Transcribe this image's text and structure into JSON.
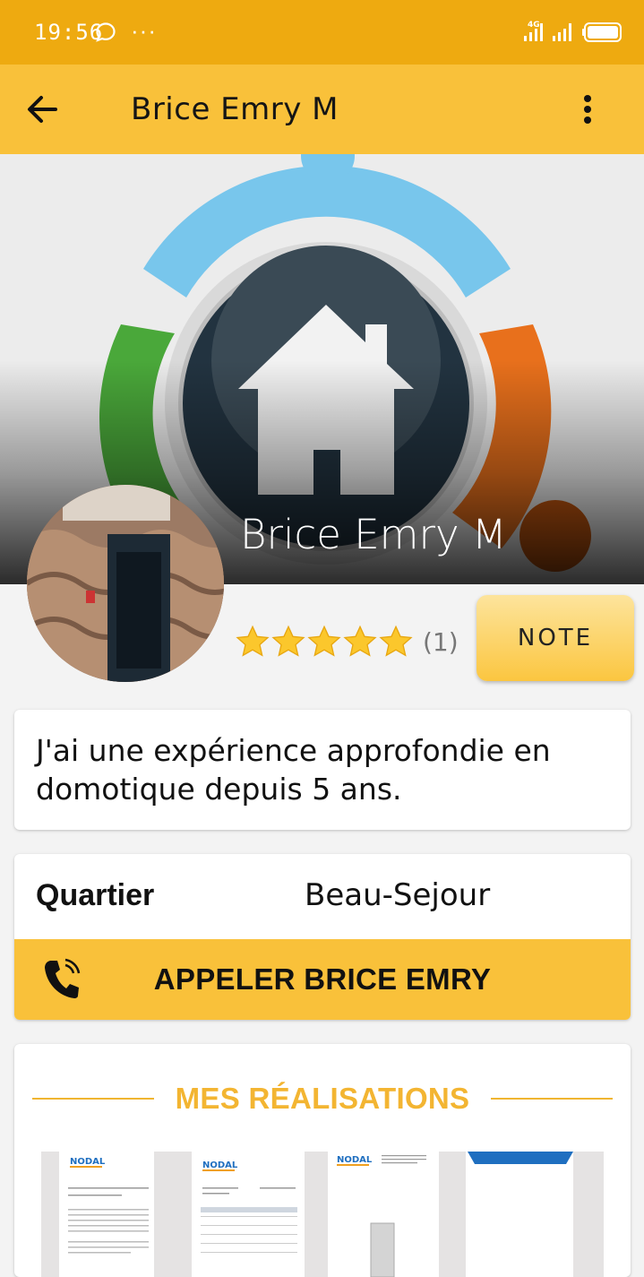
{
  "status_bar": {
    "time": "19:56",
    "dots": "···",
    "network": "4G",
    "icons": [
      "chat-bubble-icon",
      "signal-icon",
      "signal-icon",
      "battery-icon"
    ]
  },
  "app_bar": {
    "title": "Brice Emry M",
    "back_icon": "arrow-left-icon",
    "menu_icon": "more-vert-icon"
  },
  "hero": {
    "name": "Brice Emry M",
    "cover_image": "domotique-house-logo"
  },
  "profile": {
    "rating_stars": 5,
    "rating_count": "(1)",
    "note_button": "NOTE"
  },
  "description": "J'ai une expérience approfondie en domotique depuis 5 ans.",
  "info": {
    "quartier_label": "Quartier",
    "quartier_value": "Beau-Sejour",
    "call_button": "APPELER BRICE EMRY",
    "call_icon": "phone-icon"
  },
  "realisations": {
    "title": "MES RÉALISATIONS",
    "items": [
      {
        "label": "NODAL"
      },
      {
        "label": "NODAL"
      },
      {
        "label": "NODAL"
      },
      {
        "label": ""
      }
    ]
  },
  "colors": {
    "status_bar": "#eeaa10",
    "accent": "#f9c13a",
    "title_accent": "#f3b532"
  }
}
